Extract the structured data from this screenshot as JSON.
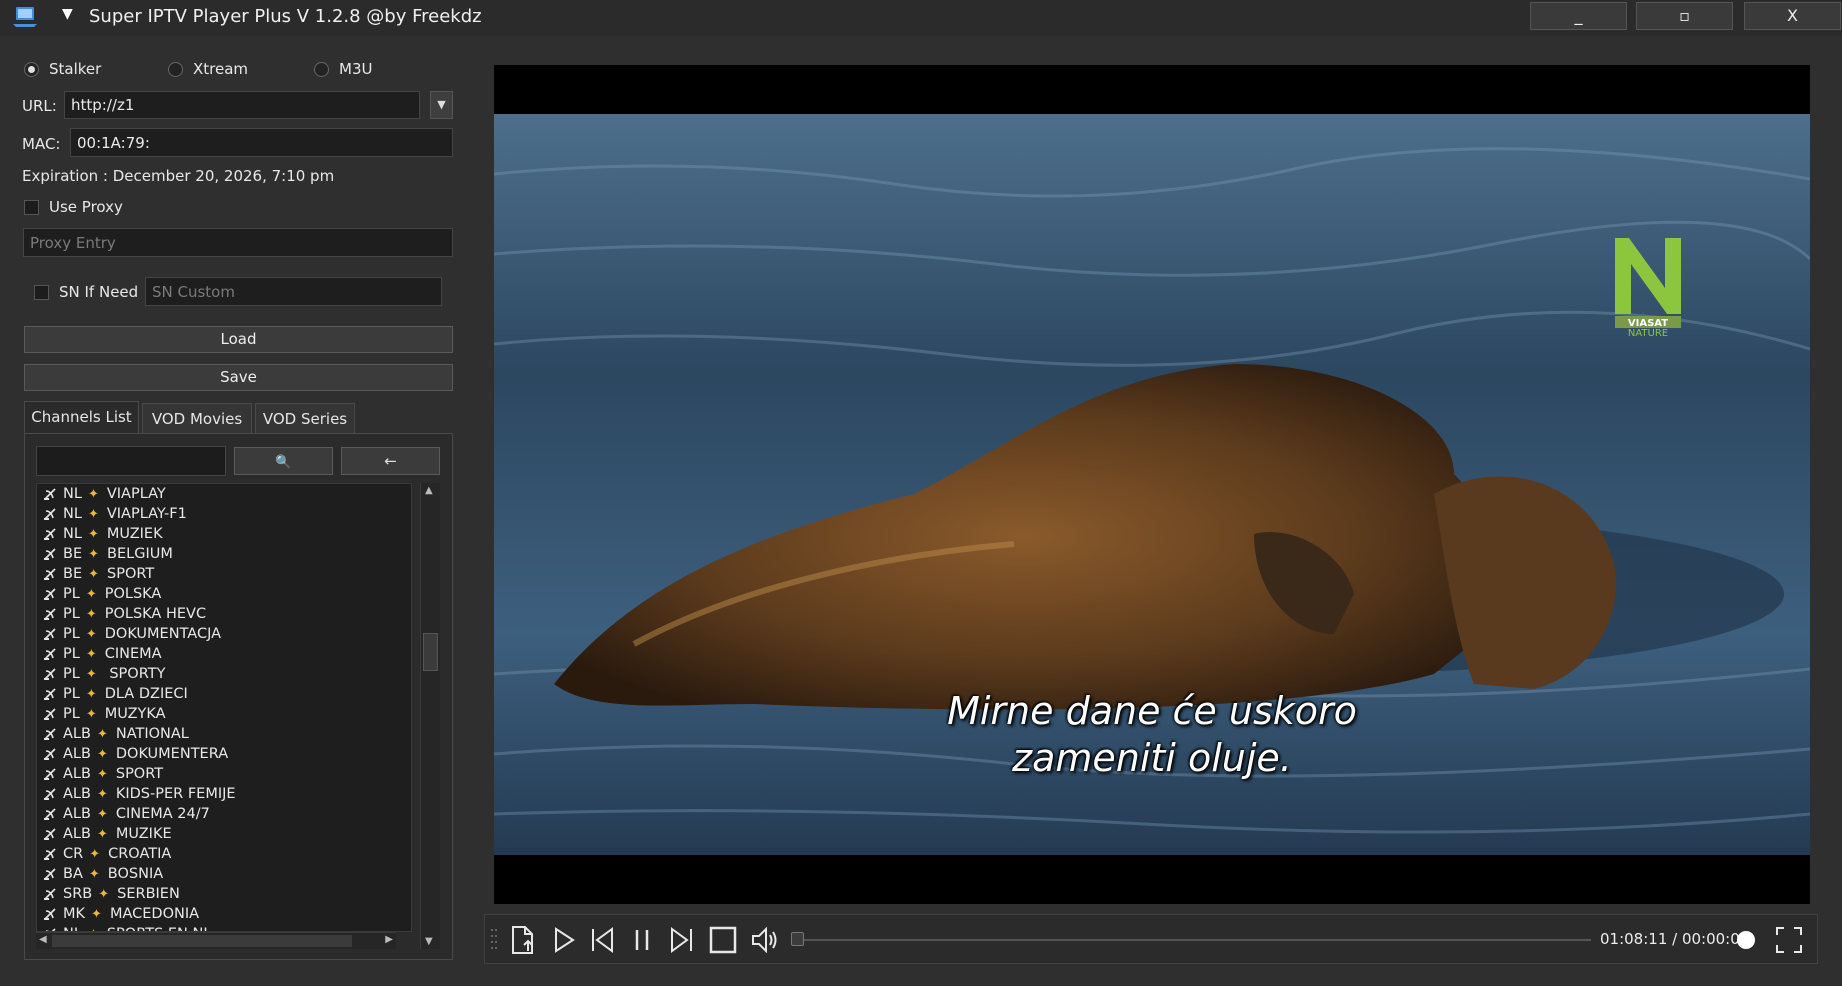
{
  "window": {
    "title": "Super IPTV Player Plus V 1.2.8 @by Freekdz",
    "minimize_label": "_",
    "maximize_label": "▫",
    "close_label": "X"
  },
  "source_type": {
    "options": [
      "Stalker",
      "Xtream",
      "M3U"
    ],
    "selected": "Stalker"
  },
  "form": {
    "url_label": "URL:",
    "url_value": "http://z1",
    "mac_label": "MAC:",
    "mac_value": "00:1A:79:",
    "expiration": "Expiration : December 20, 2026, 7:10 pm",
    "use_proxy_label": "Use Proxy",
    "proxy_placeholder": "Proxy Entry",
    "sn_label": "SN If Need",
    "sn_placeholder": "SN Custom",
    "load_label": "Load",
    "save_label": "Save"
  },
  "tabs": [
    {
      "label": "Channels List",
      "active": true
    },
    {
      "label": "VOD Movies",
      "active": false
    },
    {
      "label": "VOD Series",
      "active": false
    }
  ],
  "search": {
    "search_button": "🔍",
    "back_button": "←"
  },
  "channels": [
    {
      "prefix": "NL",
      "name": "VIAPLAY"
    },
    {
      "prefix": "NL",
      "name": "VIAPLAY-F1"
    },
    {
      "prefix": "NL",
      "name": "MUZIEK"
    },
    {
      "prefix": "BE",
      "name": "BELGIUM"
    },
    {
      "prefix": "BE",
      "name": "SPORT"
    },
    {
      "prefix": "PL",
      "name": "POLSKA"
    },
    {
      "prefix": "PL",
      "name": "POLSKA HEVC"
    },
    {
      "prefix": "PL",
      "name": "DOKUMENTACJA"
    },
    {
      "prefix": "PL",
      "name": "CINEMA"
    },
    {
      "prefix": "PL",
      "name": " SPORTY"
    },
    {
      "prefix": "PL",
      "name": "DLA DZIECI"
    },
    {
      "prefix": "PL",
      "name": "MUZYKA"
    },
    {
      "prefix": "ALB",
      "name": "NATIONAL"
    },
    {
      "prefix": "ALB",
      "name": "DOKUMENTERA"
    },
    {
      "prefix": "ALB",
      "name": "SPORT"
    },
    {
      "prefix": "ALB",
      "name": "KIDS-PER FEMIJE"
    },
    {
      "prefix": "ALB",
      "name": "CINEMA 24/7"
    },
    {
      "prefix": "ALB",
      "name": "MUZIKE"
    },
    {
      "prefix": "CR",
      "name": "CROATIA"
    },
    {
      "prefix": "BA",
      "name": "BOSNIA"
    },
    {
      "prefix": "SRB",
      "name": "SERBIEN"
    },
    {
      "prefix": "MK",
      "name": "MACEDONIA"
    },
    {
      "prefix": "NL",
      "name": "SPORTS EN NL"
    }
  ],
  "video": {
    "subtitle_line1": "Mirne dane će uskoro",
    "subtitle_line2": "zameniti oluje.",
    "channel_logo": {
      "letter": "N",
      "brand": "VIASAT",
      "sub": "NATURE"
    }
  },
  "player": {
    "time": "01:08:11 / 00:00:00",
    "icons": [
      "open-file-icon",
      "play-icon",
      "previous-icon",
      "pause-icon",
      "next-icon",
      "stop-icon",
      "volume-icon",
      "fullscreen-icon"
    ]
  }
}
